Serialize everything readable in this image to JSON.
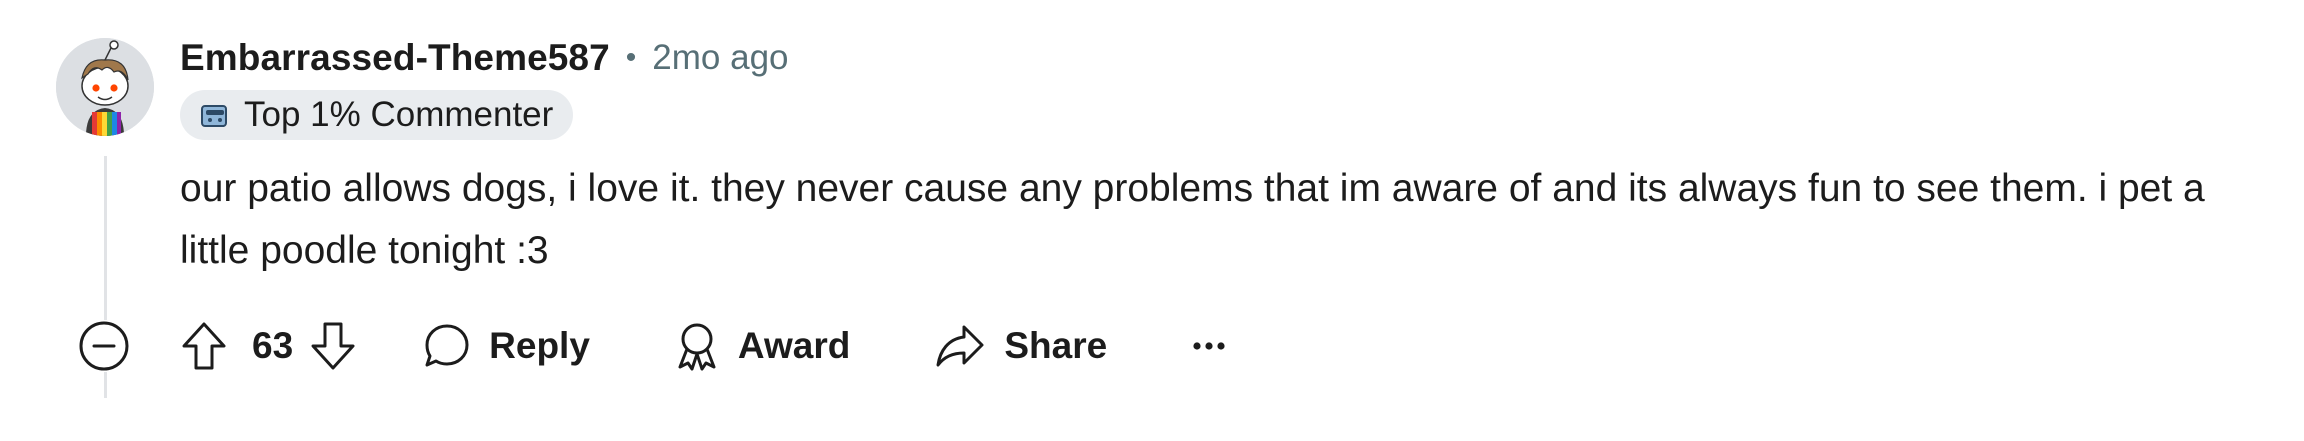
{
  "comment": {
    "author": "Embarrassed-Theme587",
    "separator": "•",
    "timestamp": "2mo ago",
    "flair": {
      "icon": "commenter-badge-icon",
      "label": "Top 1% Commenter"
    },
    "body": "our patio allows dogs, i love it. they never cause any problems that im aware of and its always fun to see them. i pet a little poodle tonight :3",
    "score": "63",
    "actions": {
      "reply_label": "Reply",
      "award_label": "Award",
      "share_label": "Share"
    }
  },
  "icons": {
    "collapse": "minus-circle-icon",
    "upvote": "arrow-up-icon",
    "downvote": "arrow-down-icon",
    "reply": "speech-bubble-icon",
    "award": "award-ribbon-icon",
    "share": "share-arrow-icon",
    "more": "ellipsis-icon"
  },
  "colors": {
    "text": "#1c1c1c",
    "meta": "#576f76",
    "flair_bg": "#e9ecef",
    "thread_line": "#e1e3e6"
  }
}
